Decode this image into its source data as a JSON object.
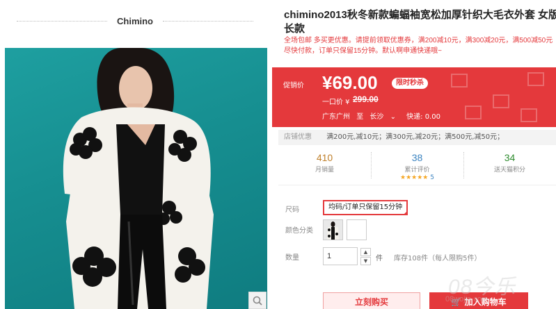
{
  "brand": {
    "name": "Chimino"
  },
  "product": {
    "title": "chimino2013秋冬新款蝙蝠袖宽松加厚针织大毛衣外套 女版长款",
    "notice": "全场包邮 多买更优惠。请提前领取优惠券，满200减10元，满300减20元，满500减50元尽快付款，订单只保留15分钟。默认啊申通快递哦~"
  },
  "promo": {
    "label": "促销价",
    "price": "¥69.00",
    "badge": "限时秒杀",
    "original_label": "一口价 ¥",
    "original_price": "299.00",
    "ship_from": "广东广州",
    "ship_to_label": "至",
    "ship_to": "长沙",
    "express": "快递: 0.00",
    "colors": {
      "primary": "#e4393c"
    }
  },
  "shop_promo": {
    "label": "店铺优惠",
    "text": "满200元,减10元；满300元,减20元；满500元,减50元；"
  },
  "stats": [
    {
      "num": "410",
      "caption": "月销量",
      "color": "#c0802c"
    },
    {
      "num": "38",
      "caption": "累计评价",
      "stars": "★★★★★",
      "rating": "5",
      "color": "#3b83c0"
    },
    {
      "num": "34",
      "caption": "送天猫积分",
      "color": "#2f8c2f"
    }
  ],
  "options": {
    "size_label": "尺码",
    "size_value": "均码/订单只保留15分钟",
    "color_label": "颜色分类",
    "qty_label": "数量",
    "qty_value": "1",
    "qty_up": "▲",
    "qty_down": "▼",
    "unit": "件",
    "stock": "库存108件（每人限购5件）"
  },
  "actions": {
    "buy_now": "立刻购买",
    "add_to_cart": "加入购物车"
  },
  "watermark": {
    "big": "08今乐",
    "small": "08wojia.com"
  }
}
